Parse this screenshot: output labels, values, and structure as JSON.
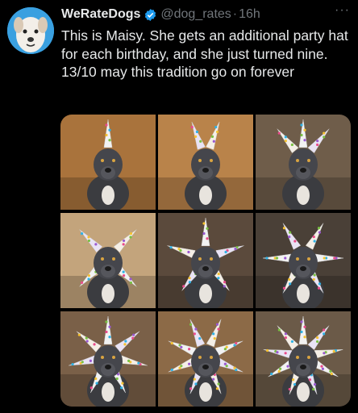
{
  "tweet": {
    "display_name": "WeRateDogs",
    "handle": "@dog_rates",
    "separator": "·",
    "time": "16h",
    "more_icon": "more-horizontal-icon",
    "verified_icon": "verified-badge-icon",
    "text": "This is Maisy. She gets an additional party hat for each birthday, and she just turned nine. 13/10 may this tradition go on forever"
  },
  "media": {
    "photos": [
      {
        "hats": 1,
        "bg": "#a9733c"
      },
      {
        "hats": 2,
        "bg": "#b9834a"
      },
      {
        "hats": 3,
        "bg": "#6f5d4a"
      },
      {
        "hats": 4,
        "bg": "#c3a47c"
      },
      {
        "hats": 5,
        "bg": "#5b4a3c"
      },
      {
        "hats": 6,
        "bg": "#4a4037"
      },
      {
        "hats": 7,
        "bg": "#7a6048"
      },
      {
        "hats": 8,
        "bg": "#8c6a47"
      },
      {
        "hats": 9,
        "bg": "#6b5a48"
      }
    ]
  },
  "colors": {
    "background": "#000000",
    "text": "#e7e9ea",
    "muted": "#71767b",
    "verified": "#1d9bf0"
  }
}
